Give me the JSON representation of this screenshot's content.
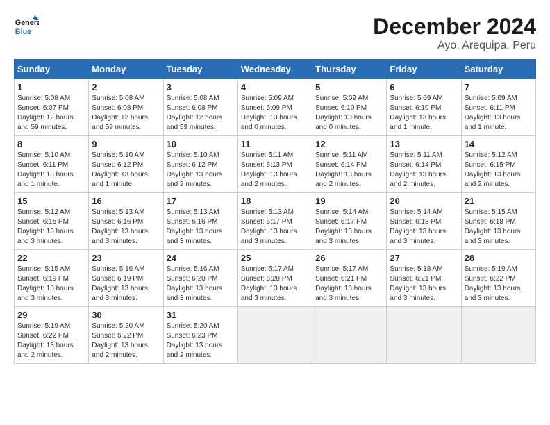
{
  "header": {
    "logo_line1": "General",
    "logo_line2": "Blue",
    "month": "December 2024",
    "location": "Ayo, Arequipa, Peru"
  },
  "weekdays": [
    "Sunday",
    "Monday",
    "Tuesday",
    "Wednesday",
    "Thursday",
    "Friday",
    "Saturday"
  ],
  "weeks": [
    [
      {
        "day": "1",
        "info": "Sunrise: 5:08 AM\nSunset: 6:07 PM\nDaylight: 12 hours\nand 59 minutes."
      },
      {
        "day": "2",
        "info": "Sunrise: 5:08 AM\nSunset: 6:08 PM\nDaylight: 12 hours\nand 59 minutes."
      },
      {
        "day": "3",
        "info": "Sunrise: 5:08 AM\nSunset: 6:08 PM\nDaylight: 12 hours\nand 59 minutes."
      },
      {
        "day": "4",
        "info": "Sunrise: 5:09 AM\nSunset: 6:09 PM\nDaylight: 13 hours\nand 0 minutes."
      },
      {
        "day": "5",
        "info": "Sunrise: 5:09 AM\nSunset: 6:10 PM\nDaylight: 13 hours\nand 0 minutes."
      },
      {
        "day": "6",
        "info": "Sunrise: 5:09 AM\nSunset: 6:10 PM\nDaylight: 13 hours\nand 1 minute."
      },
      {
        "day": "7",
        "info": "Sunrise: 5:09 AM\nSunset: 6:11 PM\nDaylight: 13 hours\nand 1 minute."
      }
    ],
    [
      {
        "day": "8",
        "info": "Sunrise: 5:10 AM\nSunset: 6:11 PM\nDaylight: 13 hours\nand 1 minute."
      },
      {
        "day": "9",
        "info": "Sunrise: 5:10 AM\nSunset: 6:12 PM\nDaylight: 13 hours\nand 1 minute."
      },
      {
        "day": "10",
        "info": "Sunrise: 5:10 AM\nSunset: 6:12 PM\nDaylight: 13 hours\nand 2 minutes."
      },
      {
        "day": "11",
        "info": "Sunrise: 5:11 AM\nSunset: 6:13 PM\nDaylight: 13 hours\nand 2 minutes."
      },
      {
        "day": "12",
        "info": "Sunrise: 5:11 AM\nSunset: 6:14 PM\nDaylight: 13 hours\nand 2 minutes."
      },
      {
        "day": "13",
        "info": "Sunrise: 5:11 AM\nSunset: 6:14 PM\nDaylight: 13 hours\nand 2 minutes."
      },
      {
        "day": "14",
        "info": "Sunrise: 5:12 AM\nSunset: 6:15 PM\nDaylight: 13 hours\nand 2 minutes."
      }
    ],
    [
      {
        "day": "15",
        "info": "Sunrise: 5:12 AM\nSunset: 6:15 PM\nDaylight: 13 hours\nand 3 minutes."
      },
      {
        "day": "16",
        "info": "Sunrise: 5:13 AM\nSunset: 6:16 PM\nDaylight: 13 hours\nand 3 minutes."
      },
      {
        "day": "17",
        "info": "Sunrise: 5:13 AM\nSunset: 6:16 PM\nDaylight: 13 hours\nand 3 minutes."
      },
      {
        "day": "18",
        "info": "Sunrise: 5:13 AM\nSunset: 6:17 PM\nDaylight: 13 hours\nand 3 minutes."
      },
      {
        "day": "19",
        "info": "Sunrise: 5:14 AM\nSunset: 6:17 PM\nDaylight: 13 hours\nand 3 minutes."
      },
      {
        "day": "20",
        "info": "Sunrise: 5:14 AM\nSunset: 6:18 PM\nDaylight: 13 hours\nand 3 minutes."
      },
      {
        "day": "21",
        "info": "Sunrise: 5:15 AM\nSunset: 6:18 PM\nDaylight: 13 hours\nand 3 minutes."
      }
    ],
    [
      {
        "day": "22",
        "info": "Sunrise: 5:15 AM\nSunset: 6:19 PM\nDaylight: 13 hours\nand 3 minutes."
      },
      {
        "day": "23",
        "info": "Sunrise: 5:16 AM\nSunset: 6:19 PM\nDaylight: 13 hours\nand 3 minutes."
      },
      {
        "day": "24",
        "info": "Sunrise: 5:16 AM\nSunset: 6:20 PM\nDaylight: 13 hours\nand 3 minutes."
      },
      {
        "day": "25",
        "info": "Sunrise: 5:17 AM\nSunset: 6:20 PM\nDaylight: 13 hours\nand 3 minutes."
      },
      {
        "day": "26",
        "info": "Sunrise: 5:17 AM\nSunset: 6:21 PM\nDaylight: 13 hours\nand 3 minutes."
      },
      {
        "day": "27",
        "info": "Sunrise: 5:18 AM\nSunset: 6:21 PM\nDaylight: 13 hours\nand 3 minutes."
      },
      {
        "day": "28",
        "info": "Sunrise: 5:19 AM\nSunset: 6:22 PM\nDaylight: 13 hours\nand 3 minutes."
      }
    ],
    [
      {
        "day": "29",
        "info": "Sunrise: 5:19 AM\nSunset: 6:22 PM\nDaylight: 13 hours\nand 2 minutes."
      },
      {
        "day": "30",
        "info": "Sunrise: 5:20 AM\nSunset: 6:22 PM\nDaylight: 13 hours\nand 2 minutes."
      },
      {
        "day": "31",
        "info": "Sunrise: 5:20 AM\nSunset: 6:23 PM\nDaylight: 13 hours\nand 2 minutes."
      },
      null,
      null,
      null,
      null
    ]
  ]
}
